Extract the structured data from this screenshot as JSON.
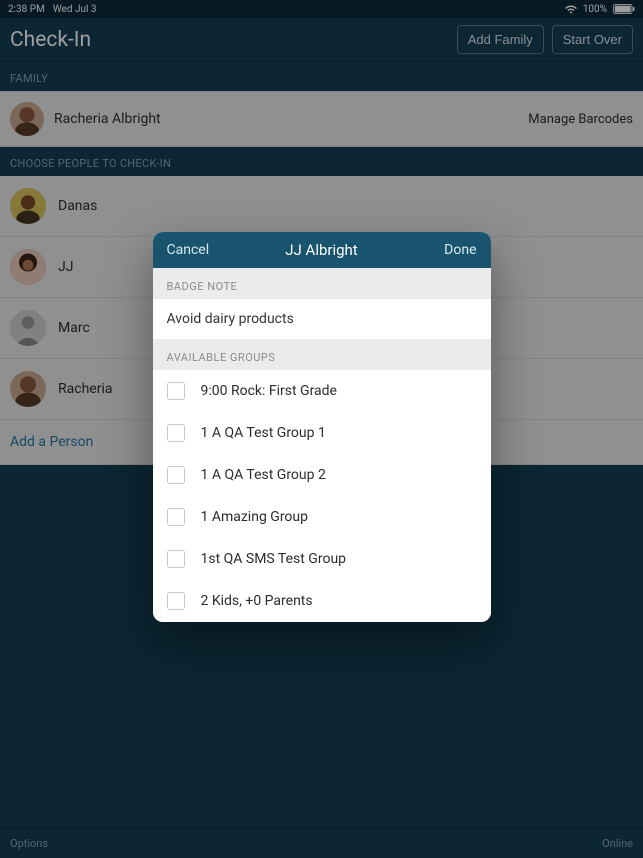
{
  "status": {
    "time": "2:38 PM",
    "date": "Wed Jul 3",
    "battery": "100%"
  },
  "nav": {
    "title": "Check-In",
    "add_family": "Add Family",
    "start_over": "Start Over"
  },
  "family": {
    "section": "FAMILY",
    "name": "Racheria Albright",
    "manage": "Manage Barcodes"
  },
  "choose": {
    "section": "CHOOSE PEOPLE TO CHECK-IN"
  },
  "people": [
    {
      "name": "Danas"
    },
    {
      "name": "JJ"
    },
    {
      "name": "Marc"
    },
    {
      "name": "Racheria"
    }
  ],
  "add_person": "Add a Person",
  "footer": {
    "options": "Options",
    "online": "Online"
  },
  "modal": {
    "cancel": "Cancel",
    "title": "JJ Albright",
    "done": "Done",
    "badge_section": "BADGE NOTE",
    "badge_note": "Avoid dairy products",
    "groups_section": "AVAILABLE GROUPS",
    "groups": [
      "9:00 Rock: First Grade",
      "1 A QA Test Group 1",
      "1 A QA Test Group 2",
      "1 Amazing Group",
      "1st QA SMS Test Group",
      "2 Kids, +0 Parents"
    ]
  }
}
